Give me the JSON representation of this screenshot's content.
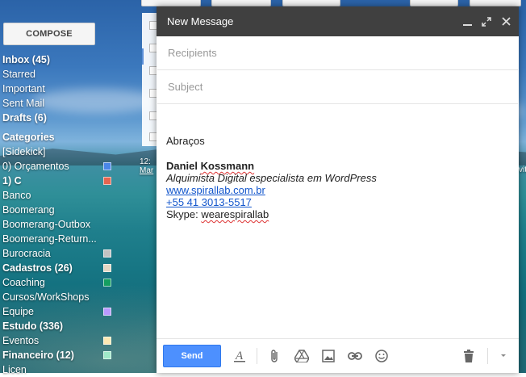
{
  "sidebar": {
    "compose_label": "COMPOSE",
    "items": [
      {
        "label": "Inbox (45)",
        "style": "bold",
        "swatch": null
      },
      {
        "label": "Starred",
        "style": "",
        "swatch": null
      },
      {
        "label": "Important",
        "style": "",
        "swatch": null
      },
      {
        "label": "Sent Mail",
        "style": "",
        "swatch": null
      },
      {
        "label": "Drafts (6)",
        "style": "bold",
        "swatch": null
      },
      {
        "label": "Categories",
        "style": "head",
        "swatch": null
      },
      {
        "label": "[Sidekick]",
        "style": "",
        "swatch": null
      },
      {
        "label": "0) Orçamentos",
        "style": "",
        "swatch": "#4a86e8"
      },
      {
        "label": "1) C",
        "style": "bold",
        "swatch": "#e66550"
      },
      {
        "label": "Banco",
        "style": "",
        "swatch": null
      },
      {
        "label": "Boomerang",
        "style": "",
        "swatch": null
      },
      {
        "label": "Boomerang-Outbox",
        "style": "",
        "swatch": null
      },
      {
        "label": "Boomerang-Return...",
        "style": "",
        "swatch": null
      },
      {
        "label": "Burocracia",
        "style": "",
        "swatch": "#c2c2c2"
      },
      {
        "label": "Cadastros (26)",
        "style": "bold",
        "swatch": "#e3d7c4"
      },
      {
        "label": "Coaching",
        "style": "",
        "swatch": "#149e60"
      },
      {
        "label": "Cursos/WorkShops",
        "style": "",
        "swatch": null
      },
      {
        "label": "Equipe",
        "style": "",
        "swatch": "#b99aff"
      },
      {
        "label": "Estudo (336)",
        "style": "bold",
        "swatch": null
      },
      {
        "label": "Eventos",
        "style": "",
        "swatch": "#fce8b3"
      },
      {
        "label": "Financeiro (12)",
        "style": "bold",
        "swatch": "#a0eac9"
      },
      {
        "label": "Licen",
        "style": "",
        "swatch": null
      }
    ]
  },
  "list": {
    "partial_time": "12:",
    "partial_text": "Mar",
    "right_edge_text": "vit"
  },
  "compose": {
    "title": "New Message",
    "recipients_placeholder": "Recipients",
    "subject_placeholder": "Subject",
    "greeting": "Abraços",
    "signature": {
      "name": "Daniel Kossmann",
      "title": "Alquimista Digital especialista em WordPress",
      "website": "www.spirallab.com.br",
      "phone": "+55 41 3013-5517",
      "skype": "Skype: wearespirallab"
    },
    "send_label": "Send"
  },
  "colors": {
    "header_bg": "#404040",
    "send_bg": "#4d90fe",
    "link": "#1155cc"
  }
}
